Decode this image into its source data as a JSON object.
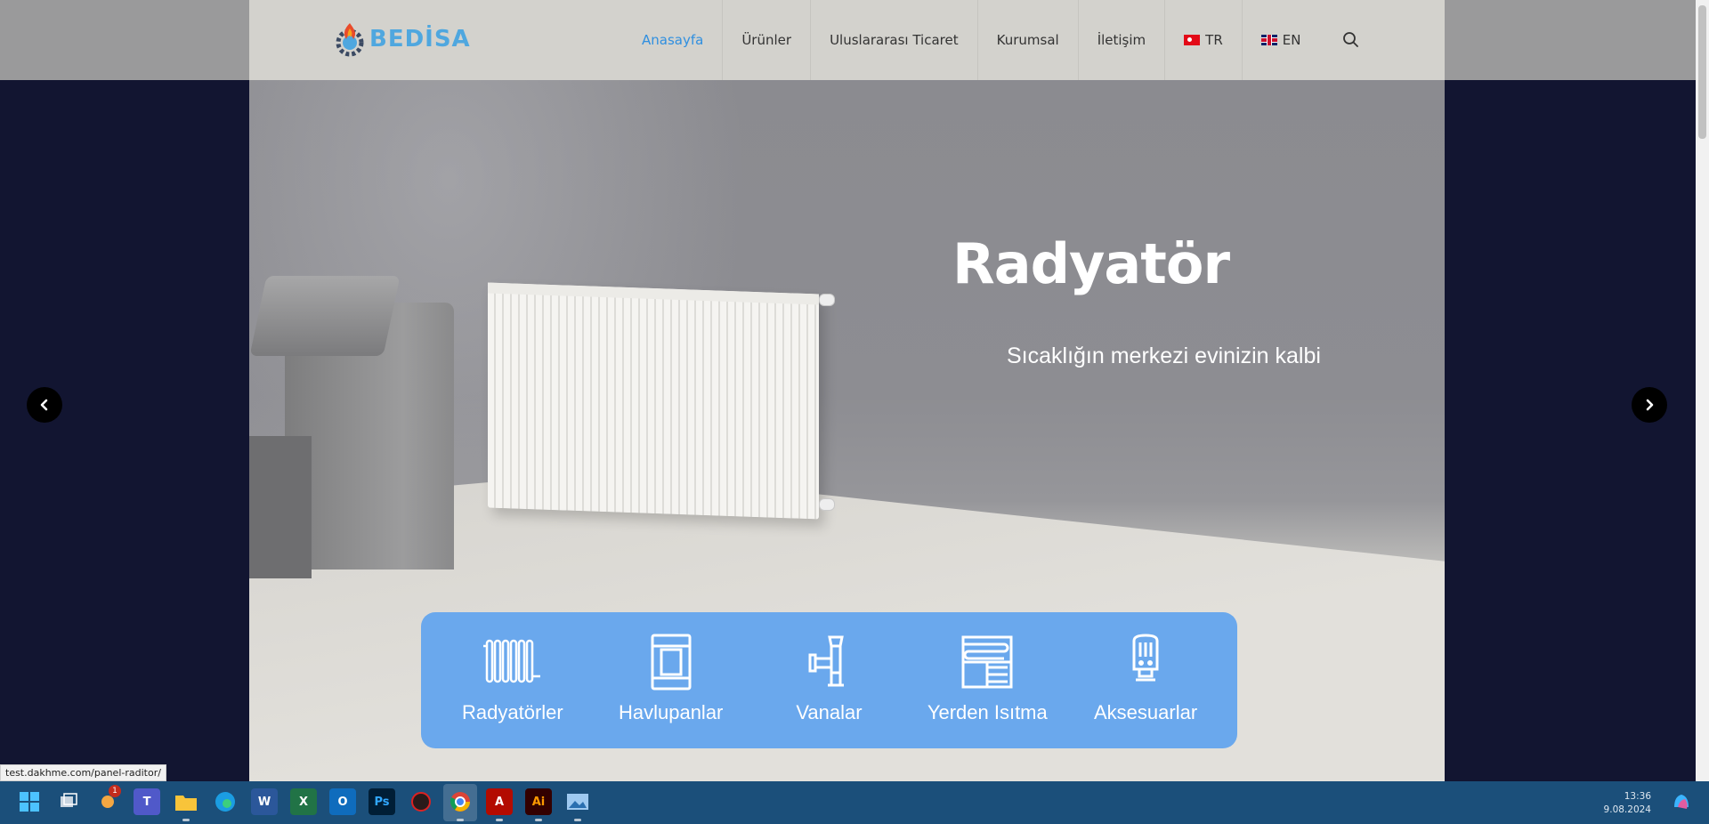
{
  "header": {
    "logo_text": "BEDİSA",
    "nav": [
      {
        "label": "Anasayfa",
        "active": true
      },
      {
        "label": "Ürünler"
      },
      {
        "label": "Uluslararası Ticaret"
      },
      {
        "label": "Kurumsal"
      },
      {
        "label": "İletişim"
      }
    ],
    "lang_tr": "TR",
    "lang_en": "EN"
  },
  "hero": {
    "title": "Radyatör",
    "subtitle": "Sıcaklığın merkezi evinizin kalbi"
  },
  "categories": [
    {
      "label": "Radyatörler",
      "icon": "radiator-icon"
    },
    {
      "label": "Havlupanlar",
      "icon": "towel-rail-icon"
    },
    {
      "label": "Vanalar",
      "icon": "valve-icon"
    },
    {
      "label": "Yerden Isıtma",
      "icon": "floor-heating-icon"
    },
    {
      "label": "Aksesuarlar",
      "icon": "thermostat-head-icon"
    }
  ],
  "status_url": "test.dakhme.com/panel-raditor/",
  "taskbar": {
    "time": "13:36",
    "date": "9.08.2024",
    "notification_count": "1"
  },
  "colors": {
    "accent": "#2f8fe0",
    "category_box": "#6aa8ed",
    "side_bg": "#121531",
    "header_bg": "#d3d2cd",
    "taskbar_bg": "#1b4f7a"
  }
}
